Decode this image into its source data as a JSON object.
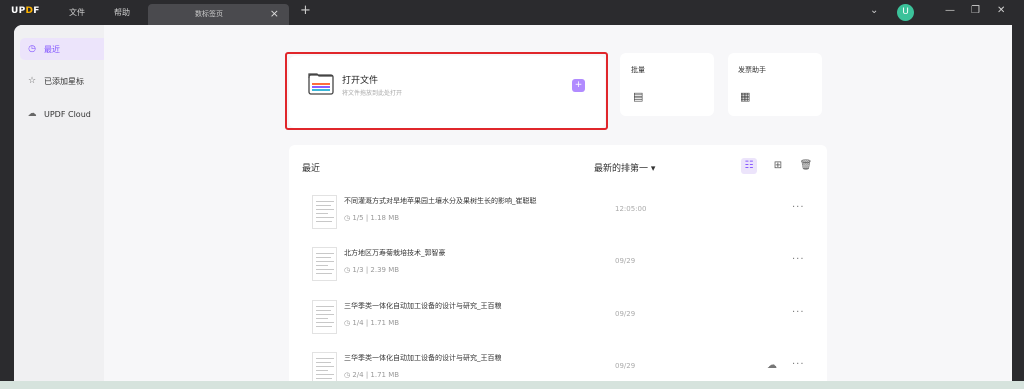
{
  "app": {
    "logo_prefix": "UP",
    "logo_accent": "D",
    "logo_suffix": "F"
  },
  "menu": {
    "file": "文件",
    "help": "帮助"
  },
  "tab": {
    "title": "数标签页",
    "close": "×",
    "add": "+"
  },
  "avatar": "U",
  "window_controls": {
    "dropdown": "⌄",
    "minimize": "—",
    "restore": "❐",
    "close": "✕"
  },
  "sidebar": {
    "items": [
      {
        "label": "最近",
        "icon": "clock-icon",
        "glyph": "◷"
      },
      {
        "label": "已添加星标",
        "icon": "star-icon",
        "glyph": "☆"
      },
      {
        "label": "UPDF Cloud",
        "icon": "cloud-icon",
        "glyph": "☁"
      }
    ]
  },
  "open_file": {
    "title": "打开文件",
    "subtitle": "将文件拖放到此处打开",
    "add": "+"
  },
  "batch": {
    "title": "批量",
    "glyph": "▤"
  },
  "invoice": {
    "title": "发票助手",
    "glyph": "▦"
  },
  "recent": {
    "title": "最近",
    "sort_label": "最新的排第一",
    "sort_arrow": "▾",
    "list_view_glyph": "☷",
    "grid_view_glyph": "⊞",
    "trash_glyph": "🗑",
    "more_glyph": "···",
    "files": [
      {
        "name": "不同灌溉方式对旱地苹果园土壤水分及果树生长的影响_崔聪聪",
        "pages": "1/5",
        "size": "1.18 MB",
        "date": "12:05:00",
        "cloud": false
      },
      {
        "name": "北方地区万寿菊栽培技术_郭智豪",
        "pages": "1/3",
        "size": "2.39 MB",
        "date": "09/29",
        "cloud": false
      },
      {
        "name": "三华季类一体化自动加工设备的设计与研究_王百粮",
        "pages": "1/4",
        "size": "1.71 MB",
        "date": "09/29",
        "cloud": false
      },
      {
        "name": "三华季类一体化自动加工设备的设计与研究_王百粮",
        "pages": "2/4",
        "size": "1.71 MB",
        "date": "09/29",
        "cloud": true
      }
    ]
  },
  "colors": {
    "accent": "#7c4dff",
    "highlight_border": "#e0262b",
    "titlebar": "#2b2b2e"
  }
}
